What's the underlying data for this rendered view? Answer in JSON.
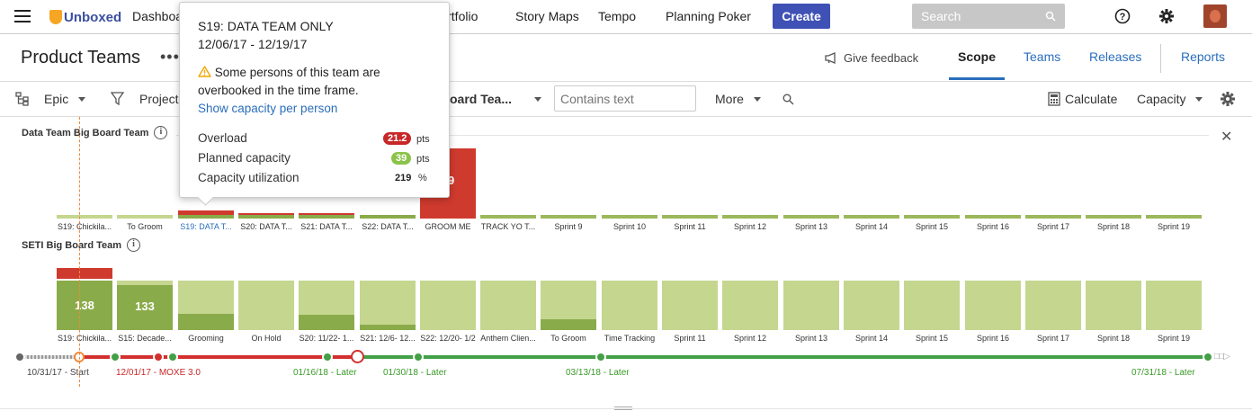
{
  "nav": {
    "logo_text": "Unboxed",
    "links": [
      "Dashboards",
      "Portfolio",
      "Story Maps",
      "Tempo",
      "Planning Poker"
    ],
    "create_label": "Create",
    "search_placeholder": "Search"
  },
  "header": {
    "title": "Product Teams",
    "more": "•••",
    "feedback": "Give feedback",
    "tabs": [
      "Scope",
      "Teams",
      "Releases",
      "Reports"
    ],
    "active_tab": "Scope"
  },
  "toolbar": {
    "epic": "Epic",
    "project": "Project",
    "board_team": "oard Tea...",
    "text_placeholder": "Contains text",
    "more": "More",
    "calculate": "Calculate",
    "capacity": "Capacity"
  },
  "teams": [
    {
      "name": "Data Team Big Board Team",
      "sprints": [
        "S19: Chickila...",
        "To Groom",
        "S19: DATA T...",
        "S20: DATA T...",
        "S21: DATA T...",
        "S22: DATA T...",
        "GROOM ME",
        "TRACK YO T...",
        "Sprint 9",
        "Sprint 10",
        "Sprint 11",
        "Sprint 12",
        "Sprint 13",
        "Sprint 14",
        "Sprint 15",
        "Sprint 16",
        "Sprint 17",
        "Sprint 18",
        "Sprint 19"
      ],
      "selected_index": 2,
      "bar_label": "39",
      "load": [
        0.06,
        0.06,
        0.09,
        0.07,
        0.07,
        0.05,
        1.0,
        0.05,
        0.05,
        0.05,
        0.05,
        0.05,
        0.05,
        0.05,
        0.05,
        0.05,
        0.05,
        0.05,
        0.05
      ],
      "over": [
        0,
        0,
        0.06,
        0.015,
        0.015,
        0,
        1.0,
        0,
        0,
        0,
        0,
        0,
        0,
        0,
        0,
        0,
        0,
        0,
        0
      ]
    },
    {
      "name": "SETI Big Board Team",
      "sprints": [
        "S19: Chickila...",
        "S15: Decade...",
        "Grooming",
        "On Hold",
        "S20: 11/22- 1...",
        "S21: 12/6- 12...",
        "S22: 12/20- 1/2",
        "Anthem Clien...",
        "To Groom",
        "Time Tracking",
        "Sprint 11",
        "Sprint 12",
        "Sprint 13",
        "Sprint 14",
        "Sprint 15",
        "Sprint 16",
        "Sprint 17",
        "Sprint 18",
        "Sprint 19"
      ],
      "labels": [
        "138",
        "133",
        "",
        "",
        "",
        "",
        "",
        "",
        "",
        "",
        "",
        "",
        "",
        "",
        "",
        "",
        "",
        "",
        ""
      ],
      "fill": [
        1.0,
        0.9,
        0.33,
        0,
        0.3,
        0.1,
        0,
        0,
        0.22,
        0,
        0,
        0,
        0,
        0,
        0,
        0,
        0,
        0,
        0
      ],
      "over": [
        0.36,
        0,
        0,
        0,
        0,
        0,
        0,
        0,
        0,
        0,
        0,
        0,
        0,
        0,
        0,
        0,
        0,
        0,
        0
      ]
    }
  ],
  "timeline": {
    "labels": [
      {
        "text": "10/31/17 - Start",
        "color": "#444"
      },
      {
        "text": "12/01/17 - MOXE 3.0",
        "color": "#c62828"
      },
      {
        "text": "01/16/18 - Later",
        "color": "#3a9a2a"
      },
      {
        "text": "01/30/18 - Later",
        "color": "#3a9a2a"
      },
      {
        "text": "03/13/18 - Later",
        "color": "#3a9a2a"
      },
      {
        "text": "07/31/18 - Later",
        "color": "#3a9a2a"
      }
    ]
  },
  "popup": {
    "title": "S19: DATA TEAM ONLY",
    "dates": "12/06/17 - 12/19/17",
    "warning": "Some persons of this team are overbooked in the time frame.",
    "link": "Show capacity per person",
    "rows": [
      {
        "label": "Overload",
        "value": "21.2",
        "unit": "pts",
        "badge_color": "#c62828"
      },
      {
        "label": "Planned capacity",
        "value": "39",
        "unit": "pts",
        "badge_color": "#8bc34a"
      },
      {
        "label": "Capacity utilization",
        "value": "219",
        "unit": "%",
        "badge_color": ""
      }
    ]
  },
  "colors": {
    "light_green": "#c5d68f",
    "dark_green": "#8aab4a",
    "red": "#cf3a2e",
    "accent": "#3f51b5",
    "link": "#2a6ebb"
  }
}
